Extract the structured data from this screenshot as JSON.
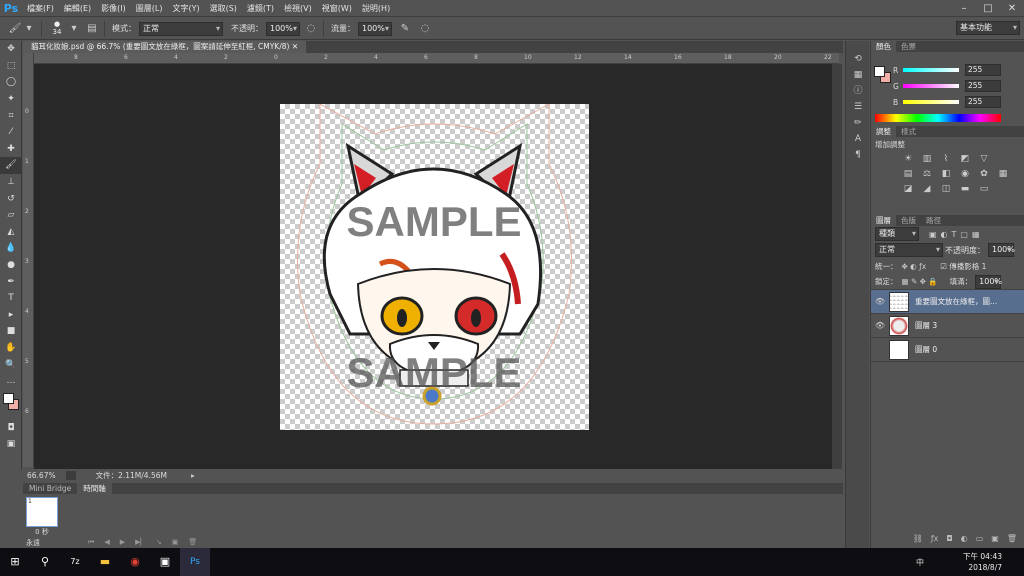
{
  "app": {
    "logo": "Ps"
  },
  "menu": [
    "檔案(F)",
    "編輯(E)",
    "影像(I)",
    "圖層(L)",
    "文字(Y)",
    "選取(S)",
    "濾鏡(T)",
    "檢視(V)",
    "視窗(W)",
    "說明(H)"
  ],
  "options": {
    "brush_size": "34",
    "mode_label": "模式：",
    "mode_value": "正常",
    "opacity_label": "不透明：",
    "opacity_value": "100%",
    "flow_label": "流量：",
    "flow_value": "100%",
    "workspace": "基本功能"
  },
  "document": {
    "tab_title": "貓耳化妝娘.psd @ 66.7% (重要圖文放在綠框，圖案請延伸至紅框, CMYK/8)",
    "watermark": "SAMPLE",
    "ruler_top": [
      "8",
      "6",
      "4",
      "2",
      "0",
      "2",
      "4",
      "6",
      "8",
      "10",
      "12",
      "14",
      "16",
      "18",
      "20",
      "22"
    ],
    "ruler_left": [
      "0",
      "1",
      "2",
      "3",
      "4",
      "5",
      "6"
    ]
  },
  "status": {
    "zoom": "66.67%",
    "doc_size": "文件：2.11M/4.56M"
  },
  "timeline": {
    "tabs": [
      "Mini Bridge",
      "時間軸"
    ],
    "frame_number": "1",
    "frame_delay": "0 秒",
    "loop": "永遠"
  },
  "color_panel": {
    "tabs": [
      "顏色",
      "色票"
    ],
    "channels": [
      {
        "label": "R",
        "value": "255"
      },
      {
        "label": "G",
        "value": "255"
      },
      {
        "label": "B",
        "value": "255"
      }
    ]
  },
  "adjust_panel": {
    "tabs": [
      "調整",
      "樣式"
    ],
    "title": "增加調整"
  },
  "layers_panel": {
    "tabs": [
      "圖層",
      "色版",
      "路徑"
    ],
    "filter": "種類",
    "blend": "正常",
    "opacity_label": "不透明度：",
    "opacity_value": "100%",
    "unify_label": "統一：",
    "propagate_label": "傳播影格 1",
    "lock_label": "鎖定：",
    "fill_label": "填滿：",
    "fill_value": "100%",
    "layers": [
      {
        "name": "重要圖文放在綠框，圖...",
        "selected": true
      },
      {
        "name": "圖層 3",
        "selected": false
      },
      {
        "name": "圖層 0",
        "selected": false
      }
    ]
  },
  "taskbar": {
    "time": "下午 04:43",
    "date": "2018/8/7",
    "ime": "中"
  }
}
